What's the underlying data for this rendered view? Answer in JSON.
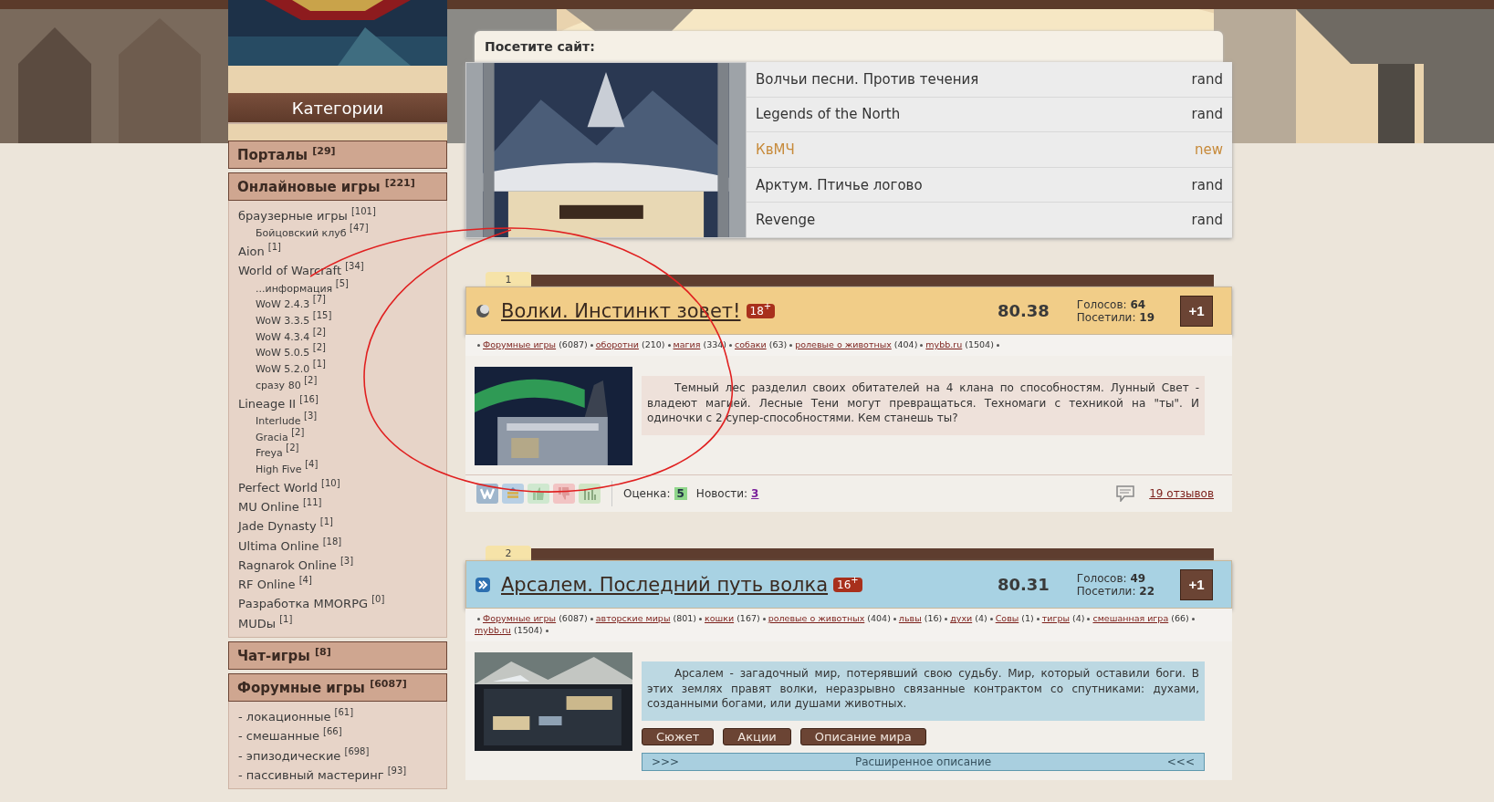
{
  "sidebar": {
    "title": "Категории",
    "categories": [
      {
        "title": "Порталы",
        "count": "[29]"
      },
      {
        "title": "Онлайновые игры",
        "count": "[221]",
        "items": [
          {
            "label": "браузерные игры",
            "count": "[101]",
            "children": [
              {
                "label": "Бойцовский клуб",
                "count": "[47]"
              }
            ]
          },
          {
            "label": "Aion",
            "count": "[1]"
          },
          {
            "label": "World of Warcraft",
            "count": "[34]",
            "children": [
              {
                "label": "...информация",
                "count": "[5]"
              },
              {
                "label": "WoW 2.4.3",
                "count": "[7]"
              },
              {
                "label": "WoW 3.3.5",
                "count": "[15]"
              },
              {
                "label": "WoW 4.3.4",
                "count": "[2]"
              },
              {
                "label": "WoW 5.0.5",
                "count": "[2]"
              },
              {
                "label": "WoW 5.2.0",
                "count": "[1]"
              },
              {
                "label": "сразу 80",
                "count": "[2]"
              }
            ]
          },
          {
            "label": "Lineage II",
            "count": "[16]",
            "children": [
              {
                "label": "Interlude",
                "count": "[3]"
              },
              {
                "label": "Gracia",
                "count": "[2]"
              },
              {
                "label": "Freya",
                "count": "[2]"
              },
              {
                "label": "High Five",
                "count": "[4]"
              }
            ]
          },
          {
            "label": "Perfect World",
            "count": "[10]"
          },
          {
            "label": "MU Online",
            "count": "[11]"
          },
          {
            "label": "Jade Dynasty",
            "count": "[1]"
          },
          {
            "label": "Ultima Online",
            "count": "[18]"
          },
          {
            "label": "Ragnarok Online",
            "count": "[3]"
          },
          {
            "label": "RF Online",
            "count": "[4]"
          },
          {
            "label": "Разработка MMORPG",
            "count": "[0]"
          },
          {
            "label": "MUDы",
            "count": "[1]"
          }
        ]
      },
      {
        "title": "Чат-игры",
        "count": "[8]"
      },
      {
        "title": "Форумные игры",
        "count": "[6087]",
        "items": [
          {
            "label": "- локационные",
            "count": "[61]"
          },
          {
            "label": "- смешанные",
            "count": "[66]"
          },
          {
            "label": "- эпизодические",
            "count": "[698]"
          },
          {
            "label": "- пассивный мастеринг",
            "count": "[93]"
          }
        ]
      }
    ]
  },
  "visit": {
    "title": "Посетите сайт:",
    "sites": [
      {
        "name": "Волчьи песни. Против течения",
        "tag": "rand",
        "highlighted": false
      },
      {
        "name": "Legends of the North",
        "tag": "rand",
        "highlighted": false
      },
      {
        "name": "КвМЧ",
        "tag": "new",
        "highlighted": true
      },
      {
        "name": "Арктум. Птичье логово",
        "tag": "rand",
        "highlighted": false
      },
      {
        "name": "Revenge",
        "tag": "rand",
        "highlighted": false
      }
    ]
  },
  "listings": [
    {
      "number": "1",
      "kind": "moon",
      "color": "#f1cd88",
      "title": "Волки. Инстинкт зовет!",
      "age": "18$^{+}$",
      "score": "80.38",
      "votes_label": "Голосов:",
      "votes": "64",
      "visits_label": "Посетили:",
      "visits": "19",
      "plus": "+1",
      "tags": [
        {
          "label": "Форумные игры",
          "count": "(6087)"
        },
        {
          "label": "оборотни",
          "count": "(210)"
        },
        {
          "label": "магия",
          "count": "(334)"
        },
        {
          "label": "собаки",
          "count": "(63)"
        },
        {
          "label": "ролевые о животных",
          "count": "(404)"
        },
        {
          "label": "mybb.ru",
          "count": "(1504)"
        }
      ],
      "description": "Темный лес разделил своих обитателей на 4 клана по способностям. Лунный Свет - владеют магией. Лесные Тени могут превращаться. Техномаги с техникой на \"ты\". И одиночки с 2 супер-способностями. Кем станешь ты?",
      "footer": {
        "rating_label": "Оценка:",
        "rating": "5",
        "news_label": "Новости:",
        "news": "3",
        "reviews": "19 отзывов"
      }
    },
    {
      "number": "2",
      "kind": "arrows",
      "color": "#a8d2e3",
      "title": "Арсалем. Последний путь волка",
      "age": "16$^{+}$",
      "score": "80.31",
      "votes_label": "Голосов:",
      "votes": "49",
      "visits_label": "Посетили:",
      "visits": "22",
      "plus": "+1",
      "tags": [
        {
          "label": "Форумные игры",
          "count": "(6087)"
        },
        {
          "label": "авторские миры",
          "count": "(801)"
        },
        {
          "label": "кошки",
          "count": "(167)"
        },
        {
          "label": "ролевые о животных",
          "count": "(404)"
        },
        {
          "label": "львы",
          "count": "(16)"
        },
        {
          "label": "духи",
          "count": "(4)"
        },
        {
          "label": "Совы",
          "count": "(1)"
        },
        {
          "label": "тигры",
          "count": "(4)"
        },
        {
          "label": "смешанная игра",
          "count": "(66)"
        },
        {
          "label": "mybb.ru",
          "count": "(1504)"
        }
      ],
      "description": "Арсалем - загадочный мир, потерявший свою судьбу. Мир, который оставили боги. В этих землях правят волки, неразрывно связанные контрактом со спутниками: духами, созданными богами, или душами животных.",
      "buttons": [
        "Сюжет",
        "Акции",
        "Описание мира"
      ],
      "expander": {
        "left": ">>>",
        "label": "Расширенное описание",
        "right": "<<<"
      }
    }
  ]
}
